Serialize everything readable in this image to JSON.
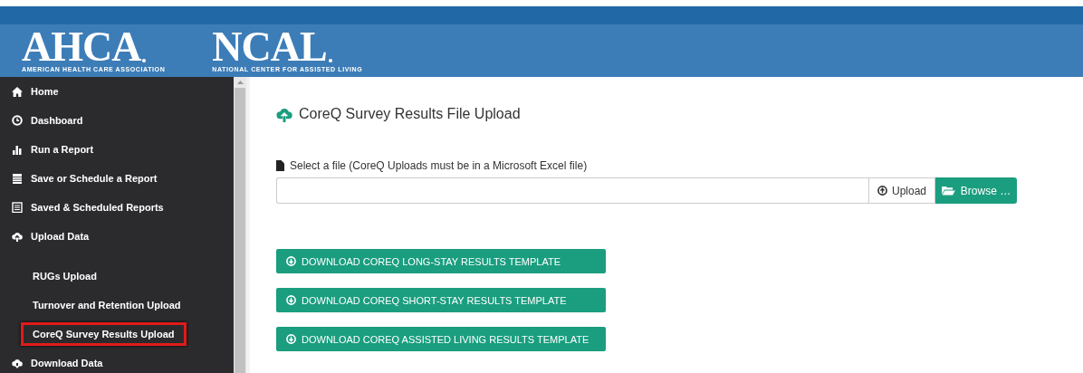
{
  "header": {
    "logos": [
      {
        "name": "AHCA",
        "subtitle": "AMERICAN HEALTH CARE ASSOCIATION"
      },
      {
        "name": "NCAL",
        "subtitle": "NATIONAL CENTER FOR ASSISTED LIVING"
      }
    ]
  },
  "sidebar": {
    "items": [
      {
        "kind": "item",
        "label": "Home",
        "selected": false
      },
      {
        "kind": "item",
        "label": "Dashboard",
        "selected": false
      },
      {
        "kind": "item",
        "label": "Run a Report",
        "selected": false
      },
      {
        "kind": "item",
        "label": "Save or Schedule a Report",
        "selected": false
      },
      {
        "kind": "item",
        "label": "Saved & Scheduled Reports",
        "selected": false
      },
      {
        "kind": "item",
        "label": "Upload Data",
        "selected": false
      },
      {
        "kind": "subitem",
        "label": "RUGs Upload",
        "selected": false
      },
      {
        "kind": "subitem",
        "label": "Turnover and Retention Upload",
        "selected": false
      },
      {
        "kind": "subitem",
        "label": "CoreQ Survey Results Upload",
        "selected": true
      },
      {
        "kind": "item",
        "label": "Download Data",
        "selected": false
      }
    ]
  },
  "main": {
    "title": "CoreQ Survey Results File Upload",
    "file_label": "Select a file (CoreQ Uploads must be in a Microsoft Excel file)",
    "upload_button": "Upload",
    "browse_button": "Browse …",
    "download_buttons": [
      "DOWNLOAD COREQ LONG-STAY RESULTS TEMPLATE",
      "DOWNLOAD COREQ SHORT-STAY RESULTS TEMPLATE",
      "DOWNLOAD COREQ ASSISTED LIVING RESULTS TEMPLATE"
    ]
  }
}
